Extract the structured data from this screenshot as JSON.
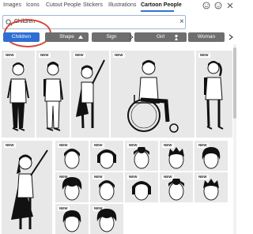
{
  "tabs": [
    {
      "label": "Images"
    },
    {
      "label": "Icons"
    },
    {
      "label": "Cutout People"
    },
    {
      "label": "Stickers"
    },
    {
      "label": "Illustrations"
    },
    {
      "label": "Cartoon People"
    }
  ],
  "active_tab": "Cartoon People",
  "search": {
    "value": "Children"
  },
  "filters": [
    {
      "label": "Children",
      "selected": true
    },
    {
      "label": "Shape",
      "selected": false
    },
    {
      "label": "Sign",
      "selected": false
    },
    {
      "label": "Girl",
      "selected": false
    },
    {
      "label": "Woman",
      "selected": false
    }
  ],
  "cards": [
    {
      "badge": "NEW",
      "subject": "boy-in-shirt"
    },
    {
      "badge": "NEW",
      "subject": "boy-with-backpack"
    },
    {
      "badge": "NEW",
      "subject": "caped-kid-pointing"
    },
    {
      "badge": "NEW",
      "subject": "person-in-wheelchair"
    },
    {
      "badge": "NEW",
      "subject": "girl-with-backpack"
    },
    {
      "badge": "NEW",
      "subject": "caped-girl-pointing"
    },
    {
      "badge": "NEW",
      "subject": "short-hair-head"
    },
    {
      "badge": "NEW",
      "subject": "bob-hair-head"
    },
    {
      "badge": "NEW",
      "subject": "bun-hair-head"
    },
    {
      "badge": "NEW",
      "subject": "spiky-hair-head"
    },
    {
      "badge": "NEW",
      "subject": "wavy-hair-head"
    },
    {
      "badge": "NEW",
      "subject": "curly-hair-head"
    },
    {
      "badge": "NEW",
      "subject": "side-part-head"
    },
    {
      "badge": "NEW",
      "subject": "flat-top-head"
    },
    {
      "badge": "NEW",
      "subject": "short-hair-head-2"
    },
    {
      "badge": "NEW",
      "subject": "bob-hair-head-2"
    },
    {
      "badge": "NEW",
      "subject": "afro-hair-head"
    },
    {
      "badge": "NEW",
      "subject": "quiff-hair-head"
    }
  ],
  "colors": {
    "accent": "#2f6fd3",
    "chip": "#6e6e6e",
    "card_bg": "#e8e8e8",
    "ring": "#d6473a"
  }
}
